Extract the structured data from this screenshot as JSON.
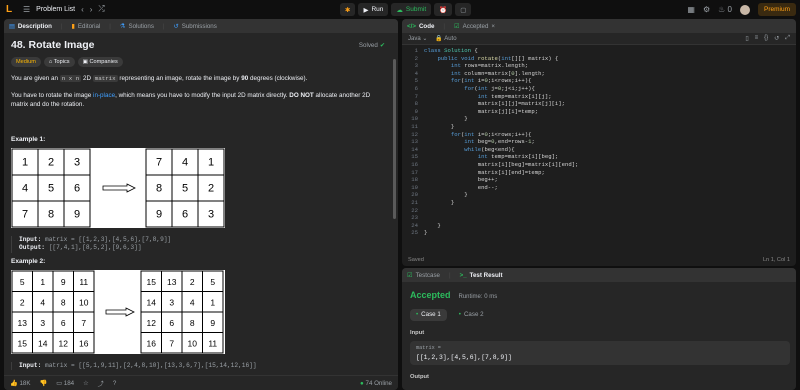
{
  "topbar": {
    "logo": "L",
    "problem_list": "Problem List",
    "run": "Run",
    "submit": "Submit",
    "streak": "0",
    "premium": "Premium"
  },
  "desc_tabs": [
    {
      "label": "Description",
      "icon": "description-icon"
    },
    {
      "label": "Editorial",
      "icon": "book-icon"
    },
    {
      "label": "Solutions",
      "icon": "flask-icon"
    },
    {
      "label": "Submissions",
      "icon": "history-icon"
    }
  ],
  "problem": {
    "title": "48. Rotate Image",
    "solved": "Solved",
    "difficulty": "Medium",
    "topics": "Topics",
    "companies": "Companies",
    "p1_a": "You are given an ",
    "p1_code": "n x n",
    "p1_b": " 2D ",
    "p1_code2": "matrix",
    "p1_c": " representing an image, rotate the image by ",
    "p1_bold": "90",
    "p1_d": " degrees (clockwise).",
    "p2_a": "You have to rotate the image ",
    "p2_link": "in-place",
    "p2_b": ", which means you have to modify the input 2D matrix directly. ",
    "p2_bold": "DO NOT",
    "p2_c": " allocate another 2D matrix and do the rotation."
  },
  "examples": [
    {
      "title": "Example 1:",
      "before": [
        [
          1,
          2,
          3
        ],
        [
          4,
          5,
          6
        ],
        [
          7,
          8,
          9
        ]
      ],
      "after": [
        [
          7,
          4,
          1
        ],
        [
          8,
          5,
          2
        ],
        [
          9,
          6,
          3
        ]
      ],
      "input_label": "Input:",
      "input": "matrix = [[1,2,3],[4,5,6],[7,8,9]]",
      "output_label": "Output:",
      "output": "[[7,4,1],[8,5,2],[9,6,3]]"
    },
    {
      "title": "Example 2:",
      "before": [
        [
          5,
          1,
          9,
          11
        ],
        [
          2,
          4,
          8,
          10
        ],
        [
          13,
          3,
          6,
          7
        ],
        [
          15,
          14,
          12,
          16
        ]
      ],
      "after": [
        [
          15,
          13,
          2,
          5
        ],
        [
          14,
          3,
          4,
          1
        ],
        [
          12,
          6,
          8,
          9
        ],
        [
          16,
          7,
          10,
          11
        ]
      ],
      "input_label": "Input:",
      "input": "matrix = [[5,1,9,11],[2,4,8,10],[13,3,6,7],[15,14,12,16]]"
    }
  ],
  "desc_footer": {
    "likes": "18K",
    "comments": "184",
    "online": "74 Online"
  },
  "code_panel": {
    "tab_code": "Code",
    "tab_accepted": "Accepted",
    "language": "Java",
    "auto": "Auto",
    "status_left": "Saved",
    "status_right": "Ln 1, Col 1",
    "lines": [
      "class Solution {",
      "    public void rotate(int[][] matrix) {",
      "        int rows=matrix.length;",
      "        int column=matrix[0].length;",
      "        for(int i=0;i<rows;i++){",
      "            for(int j=0;j<i;j++){",
      "                int temp=matrix[i][j];",
      "                matrix[i][j]=matrix[j][i];",
      "                matrix[j][i]=temp;",
      "            }",
      "        }",
      "        for(int i=0;i<rows;i++){",
      "            int beg=0,end=rows-1;",
      "            while(beg<end){",
      "                int temp=matrix[i][beg];",
      "                matrix[i][beg]=matrix[i][end];",
      "                matrix[i][end]=temp;",
      "                beg++;",
      "                end--;",
      "            }",
      "        }",
      "",
      "",
      "    }",
      "}"
    ]
  },
  "result_panel": {
    "tab_testcase": "Testcase",
    "tab_result": "Test Result",
    "status": "Accepted",
    "runtime": "Runtime: 0 ms",
    "cases": [
      "Case 1",
      "Case 2"
    ],
    "input_label": "Input",
    "var_name": "matrix =",
    "var_value": "[[1,2,3],[4,5,6],[7,8,9]]",
    "output_label": "Output"
  }
}
